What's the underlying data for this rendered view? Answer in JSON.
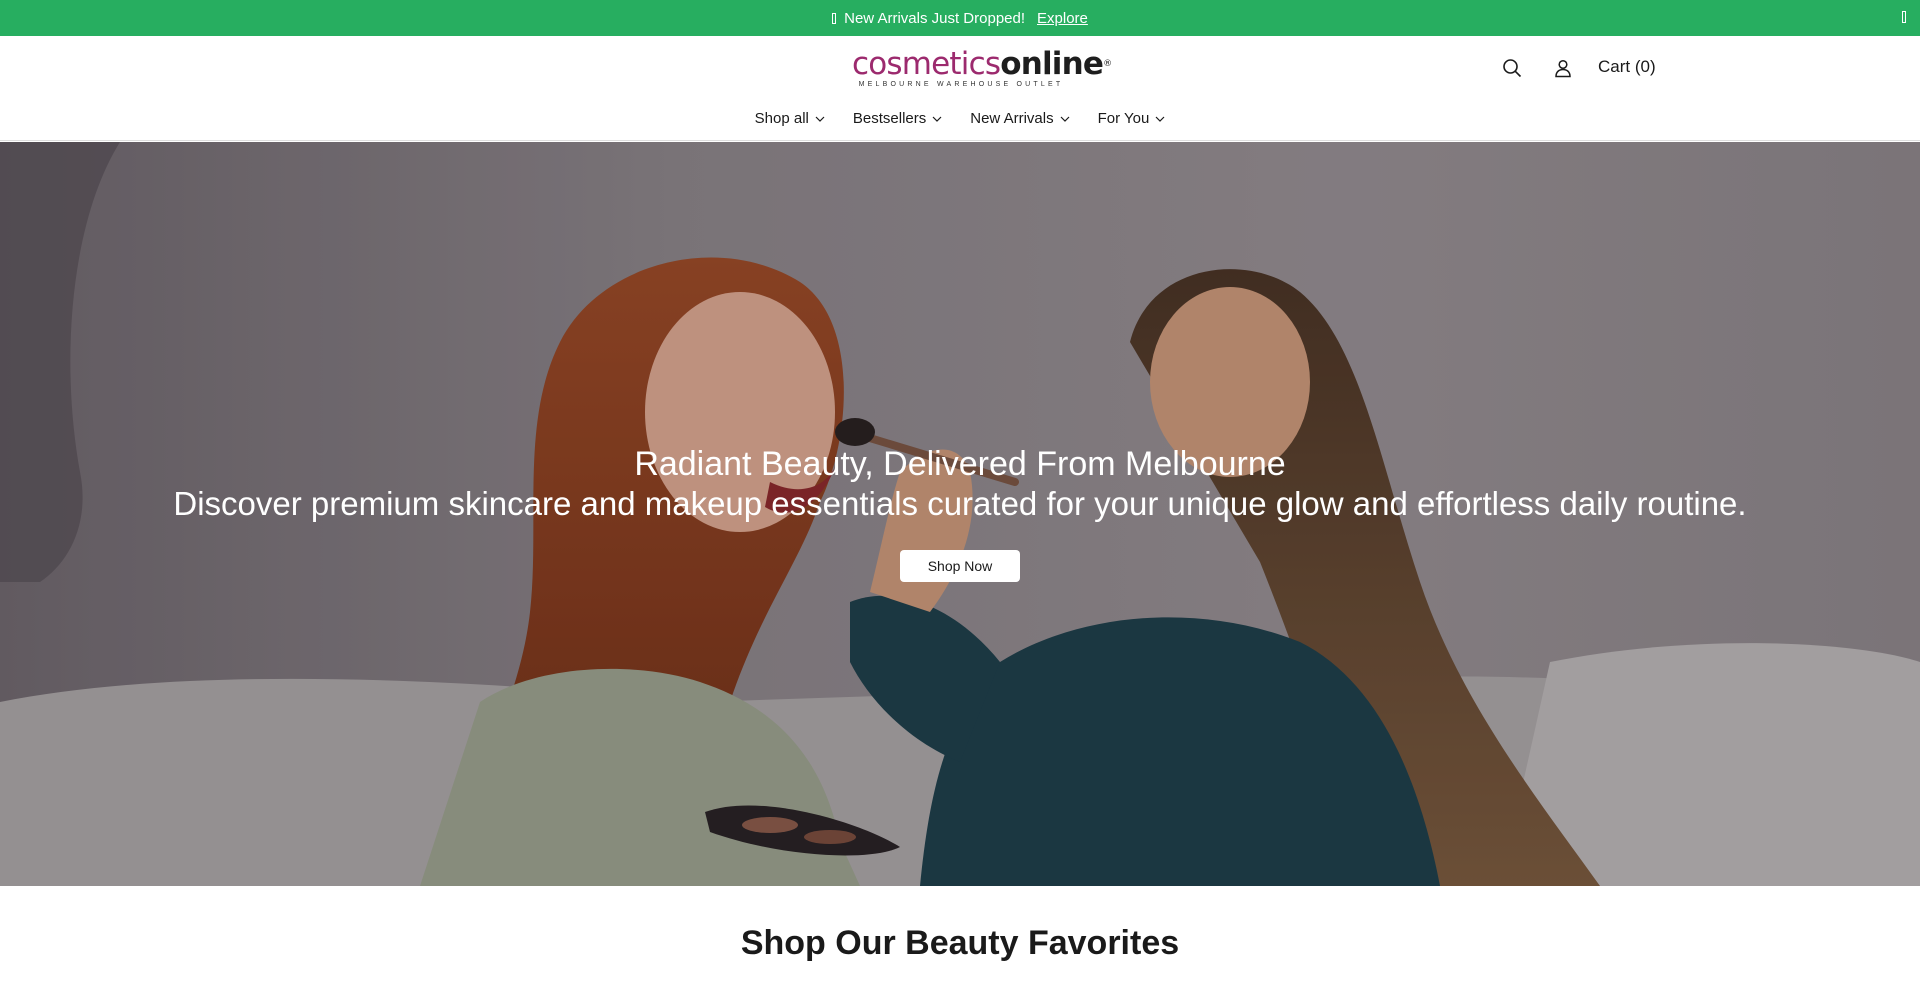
{
  "announcement": {
    "text": "New Arrivals Just Dropped!",
    "link_label": "Explore"
  },
  "header": {
    "logo": {
      "word_part1": "cosmetics",
      "word_part2": "online",
      "tagline": "MELBOURNE WAREHOUSE OUTLET"
    },
    "cart_label": "Cart (0)"
  },
  "nav": {
    "items": [
      {
        "label": "Shop all"
      },
      {
        "label": "Bestsellers"
      },
      {
        "label": "New Arrivals"
      },
      {
        "label": "For You"
      }
    ]
  },
  "hero": {
    "title": "Radiant Beauty, Delivered From Melbourne",
    "subtitle": "Discover premium skincare and makeup essentials curated for your unique glow and effortless daily routine.",
    "button_label": "Shop Now"
  },
  "section": {
    "title": "Shop Our Beauty Favorites"
  },
  "colors": {
    "announcement_bg": "#27ae60",
    "logo_accent": "#9c2a6e"
  },
  "icons": [
    "search-icon",
    "account-icon",
    "chevron-down-icon",
    "close-icon"
  ]
}
